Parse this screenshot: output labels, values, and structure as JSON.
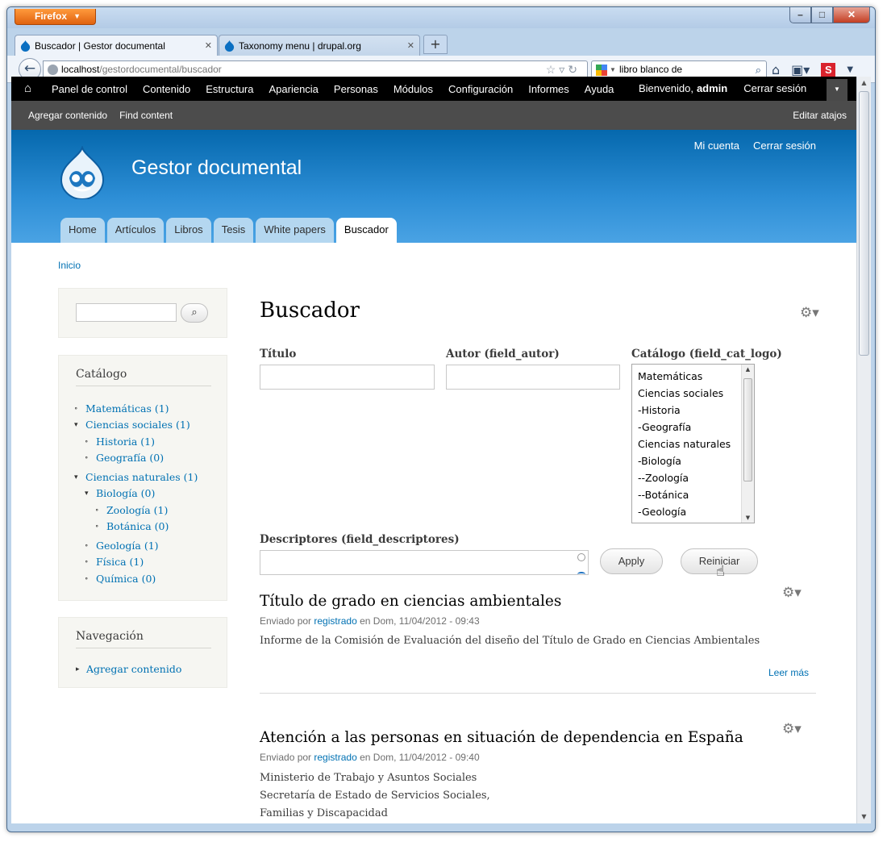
{
  "browser": {
    "app_button": "Firefox",
    "tabs": [
      {
        "title": "Buscador | Gestor documental",
        "active": true
      },
      {
        "title": "Taxonomy menu | drupal.org",
        "active": false
      }
    ],
    "url": {
      "host": "localhost",
      "path": "/gestordocumental/buscador"
    },
    "search_value": "libro blanco de"
  },
  "admin_toolbar": {
    "items": [
      "Panel de control",
      "Contenido",
      "Estructura",
      "Apariencia",
      "Personas",
      "Módulos",
      "Configuración",
      "Informes",
      "Ayuda"
    ],
    "welcome": "Bienvenido,",
    "username": "admin",
    "logout": "Cerrar sesión"
  },
  "shortcuts": {
    "items": [
      "Agregar contenido",
      "Find content"
    ],
    "edit": "Editar atajos"
  },
  "header": {
    "site_name": "Gestor documental",
    "secondary_menu": [
      "Mi cuenta",
      "Cerrar sesión"
    ],
    "tabs": [
      "Home",
      "Artículos",
      "Libros",
      "Tesis",
      "White papers",
      "Buscador"
    ],
    "active_tab": "Buscador"
  },
  "breadcrumb": "Inicio",
  "sidebar": {
    "catalog_title": "Catálogo",
    "catalog_items": [
      {
        "label": "Matemáticas (1)",
        "level": 0,
        "expanded": false
      },
      {
        "label": "Ciencias sociales (1)",
        "level": 0,
        "expanded": true
      },
      {
        "label": "Historia (1)",
        "level": 1,
        "expanded": false
      },
      {
        "label": "Geografía (0)",
        "level": 1,
        "expanded": false
      },
      {
        "label": "Ciencias naturales (1)",
        "level": 0,
        "expanded": true
      },
      {
        "label": "Biología (0)",
        "level": 1,
        "expanded": true
      },
      {
        "label": "Zoología (1)",
        "level": 2,
        "expanded": false
      },
      {
        "label": "Botánica (0)",
        "level": 2,
        "expanded": false
      },
      {
        "label": "Geología (1)",
        "level": 1,
        "expanded": false
      },
      {
        "label": "Física (1)",
        "level": 1,
        "expanded": false
      },
      {
        "label": "Química (0)",
        "level": 1,
        "expanded": false
      }
    ],
    "nav_title": "Navegación",
    "nav_items": [
      "Agregar contenido"
    ]
  },
  "main": {
    "title": "Buscador",
    "filters": {
      "titulo_label": "Título",
      "autor_label": "Autor (field_autor)",
      "catalogo_label": "Catálogo (field_cat_logo)",
      "catalogo_options": [
        "Matemáticas",
        "Ciencias sociales",
        "-Historia",
        "-Geografía",
        "Ciencias naturales",
        "-Biología",
        "--Zoología",
        "--Botánica",
        "-Geología"
      ],
      "descriptores_label": "Descriptores (field_descriptores)",
      "apply": "Apply",
      "reset": "Reiniciar"
    },
    "results": [
      {
        "title": "Título de grado en ciencias ambientales",
        "submitted_prefix": "Enviado por",
        "author": "registrado",
        "date": "en Dom, 11/04/2012 - 09:43",
        "body": [
          "Informe de la Comisión de Evaluación del diseño del Título de Grado en Ciencias Ambientales"
        ],
        "read_more": "Leer más"
      },
      {
        "title": "Atención a las personas en situación de dependencia en España",
        "submitted_prefix": "Enviado por",
        "author": "registrado",
        "date": "en Dom, 11/04/2012 - 09:40",
        "body": [
          "Ministerio de Trabajo y Asuntos Sociales",
          "Secretaría de Estado de Servicios Sociales,",
          "Familias y Discapacidad"
        ]
      }
    ]
  }
}
